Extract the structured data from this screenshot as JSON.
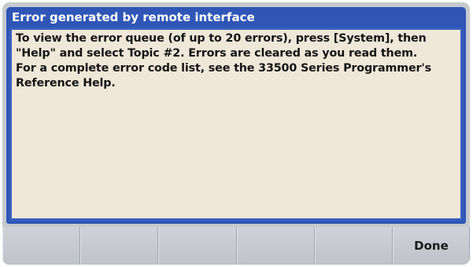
{
  "dialog": {
    "title": "Error generated by remote interface",
    "message": "To view the error queue (of up to 20 errors), press [System], then\n\"Help\" and select Topic #2. Errors are cleared as you read them.\nFor a complete error code list, see the 33500 Series Programmer's\nReference Help."
  },
  "softkeys": [
    {
      "label": ""
    },
    {
      "label": ""
    },
    {
      "label": ""
    },
    {
      "label": ""
    },
    {
      "label": ""
    },
    {
      "label": "Done"
    }
  ],
  "colors": {
    "title_bar": "#2f56b6",
    "dialog_background": "#efe7d8",
    "softkey_background": "#c6c9ce"
  }
}
